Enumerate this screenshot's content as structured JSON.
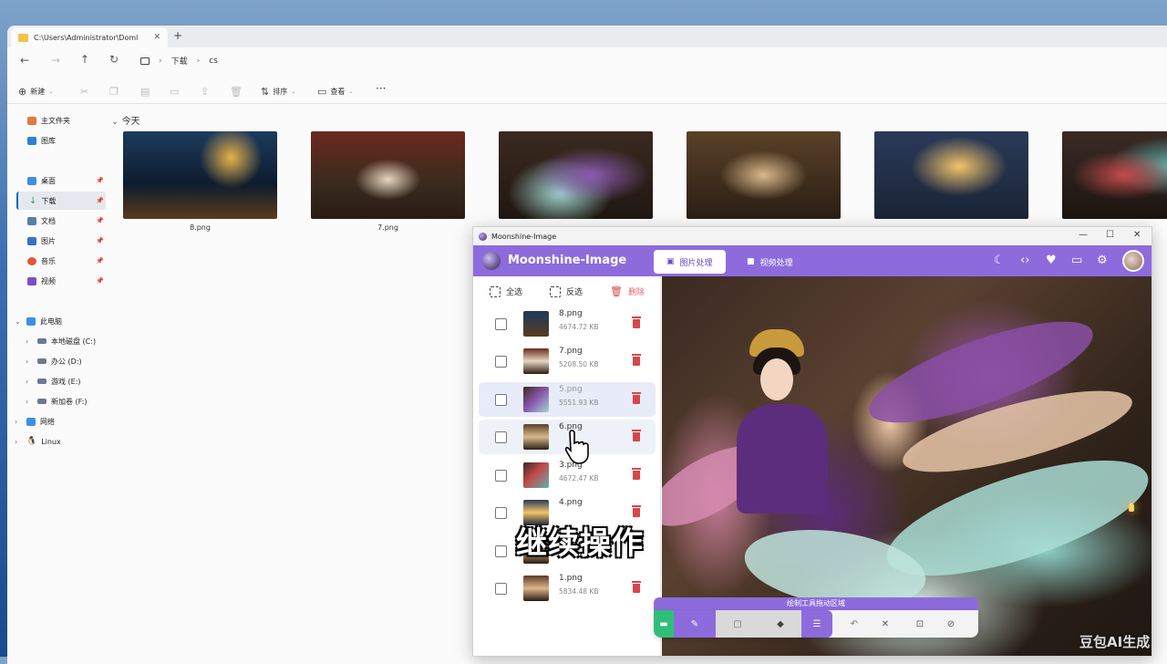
{
  "explorer": {
    "tab_title": "C:\\Users\\Administrator\\Doml",
    "tab_close": "✕",
    "new_tab": "+",
    "breadcrumb": [
      "下载",
      "cs"
    ],
    "toolbar": {
      "new": "新建",
      "sort": "排序",
      "view": "查看",
      "more": "···"
    },
    "sidebar": {
      "quick": [
        {
          "label": "主文件夹",
          "icon": "home-icon",
          "color": "#e07b39"
        },
        {
          "label": "图库",
          "icon": "gallery-icon",
          "color": "#2f7fd6"
        }
      ],
      "pinned": [
        {
          "label": "桌面",
          "icon": "desktop-icon",
          "color": "#3d8fe0"
        },
        {
          "label": "下载",
          "icon": "download-icon",
          "color": "#2e9e5b"
        },
        {
          "label": "文档",
          "icon": "document-icon",
          "color": "#5a7fa8"
        },
        {
          "label": "图片",
          "icon": "pictures-icon",
          "color": "#3a6fc4"
        },
        {
          "label": "音乐",
          "icon": "music-icon",
          "color": "#e0553d"
        },
        {
          "label": "视频",
          "icon": "video-icon",
          "color": "#7d4ec4"
        }
      ],
      "this_pc": "此电脑",
      "drives": [
        "本地磁盘 (C:)",
        "办公 (D:)",
        "游戏 (E:)",
        "新加卷 (F:)"
      ],
      "network": "网络",
      "linux": "Linux"
    },
    "group_header": "今天",
    "files": [
      {
        "name": "8.png"
      },
      {
        "name": "7.png"
      },
      {
        "name": ""
      },
      {
        "name": ""
      },
      {
        "name": ""
      },
      {
        "name": ""
      }
    ]
  },
  "app": {
    "window_title": "Moonshine-Image",
    "app_name": "Moonshine-Image",
    "tabs": [
      {
        "label": "图片处理",
        "active": true
      },
      {
        "label": "视频处理",
        "active": false
      }
    ],
    "header_icons": [
      "moon-icon",
      "code-icon",
      "heart-icon",
      "terminal-icon",
      "gear-icon",
      "avatar"
    ],
    "actions": {
      "select_all": "全选",
      "invert": "反选",
      "delete": "删除"
    },
    "files": [
      {
        "name": "8.png",
        "size": "4674.72 KB"
      },
      {
        "name": "7.png",
        "size": "5208.50 KB"
      },
      {
        "name": "5.png",
        "size": "5551.93 KB"
      },
      {
        "name": "6.png",
        "size": ""
      },
      {
        "name": "3.png",
        "size": "4672.47 KB"
      },
      {
        "name": "4.png",
        "size": ""
      },
      {
        "name": "",
        "size": ""
      },
      {
        "name": "1.png",
        "size": "5834.48 KB"
      }
    ],
    "draw_toolbar": {
      "title": "绘制工具拖动区域",
      "tools": [
        "pen-icon",
        "rectangle-icon",
        "eraser-icon",
        "adjust-icon",
        "undo-icon",
        "close-icon",
        "fit-icon",
        "hide-icon"
      ]
    },
    "colors": {
      "accent": "#8d6bdc",
      "delete": "#d6474b"
    }
  },
  "overlay": {
    "caption": "继续操作",
    "watermark": "豆包AI生成"
  }
}
